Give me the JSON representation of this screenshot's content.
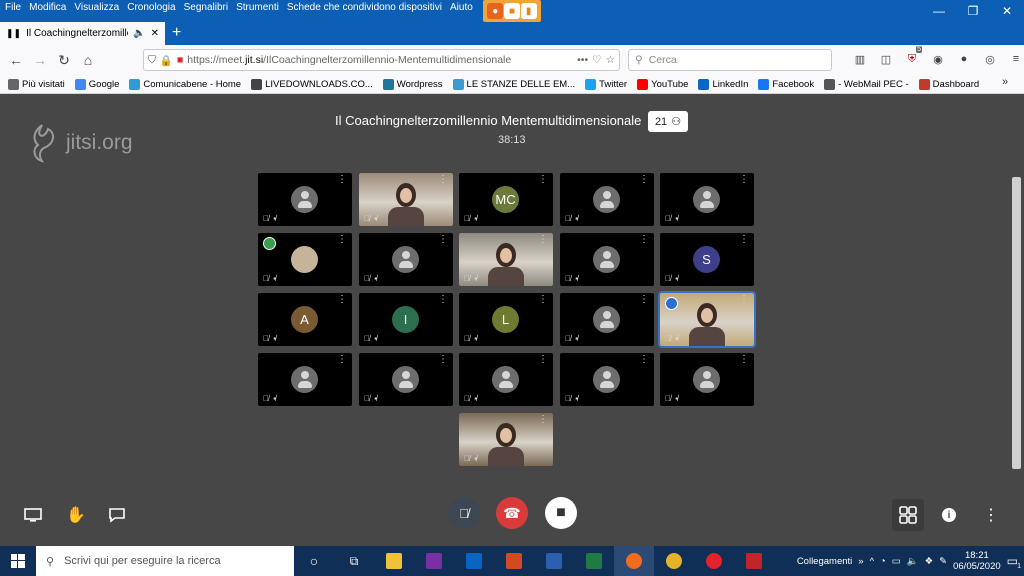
{
  "menu": [
    "File",
    "Modifica",
    "Visualizza",
    "Cronologia",
    "Segnalibri",
    "Strumenti",
    "Schede che condividono dispositivi",
    "Aiuto"
  ],
  "tab": {
    "title": "Il Coachingnelterzomillennio"
  },
  "nav": {
    "url_prefix": "https://meet.",
    "url_domain": "jit.si",
    "url_path": "/IlCoachingnelterzomillennio-Mentemultidimensionale",
    "search_placeholder": "Cerca",
    "badge": "5"
  },
  "bookmarks": [
    {
      "label": "Più visitati",
      "color": "#666"
    },
    {
      "label": "Google",
      "color": "#4285f4"
    },
    {
      "label": "Comunicabene - Home",
      "color": "#2d9cdb"
    },
    {
      "label": "LIVEDOWNLOADS.CO...",
      "color": "#444"
    },
    {
      "label": "Wordpress",
      "color": "#21759b"
    },
    {
      "label": "LE STANZE DELLE EM...",
      "color": "#3d9ad1"
    },
    {
      "label": "Twitter",
      "color": "#1da1f2"
    },
    {
      "label": "YouTube",
      "color": "#ff0000"
    },
    {
      "label": "LinkedIn",
      "color": "#0a66c2"
    },
    {
      "label": "Facebook",
      "color": "#1877f2"
    },
    {
      "label": "- WebMail PEC -",
      "color": "#555"
    },
    {
      "label": "Dashboard",
      "color": "#c0392b"
    }
  ],
  "meeting": {
    "brand": "jitsi.org",
    "title": "Il Coachingnelterzomillennio Mentemultidimensionale",
    "participants": "21",
    "timer": "38:13"
  },
  "tiles": [
    {
      "type": "generic"
    },
    {
      "type": "video",
      "tone": "#9c8b78"
    },
    {
      "type": "initial",
      "letter": "MC",
      "color": "#6b7a3b"
    },
    {
      "type": "generic"
    },
    {
      "type": "generic"
    },
    {
      "type": "photo",
      "tone": "#c5b39a",
      "conn": true
    },
    {
      "type": "generic"
    },
    {
      "type": "video",
      "tone": "#8e8a7f"
    },
    {
      "type": "generic"
    },
    {
      "type": "initial",
      "letter": "S",
      "color": "#3d3f8a"
    },
    {
      "type": "initial",
      "letter": "A",
      "color": "#7a5a33"
    },
    {
      "type": "initial",
      "letter": "I",
      "color": "#2c6e4f"
    },
    {
      "type": "initial",
      "letter": "L",
      "color": "#6d7a2f"
    },
    {
      "type": "generic"
    },
    {
      "type": "video",
      "tone": "#c4a978",
      "active": true
    },
    {
      "type": "generic"
    },
    {
      "type": "generic"
    },
    {
      "type": "generic"
    },
    {
      "type": "generic"
    },
    {
      "type": "generic"
    },
    {
      "type": "video",
      "tone": "#7a6a55"
    }
  ],
  "taskbar": {
    "search_placeholder": "Scrivi qui per eseguire la ricerca",
    "links": "Collegamenti",
    "time": "18:21",
    "date": "06/05/2020",
    "notif": "1",
    "apps": [
      {
        "name": "explorer",
        "color": "#f0c23a"
      },
      {
        "name": "onenote",
        "color": "#7a2fa5"
      },
      {
        "name": "outlook",
        "color": "#0a64c2"
      },
      {
        "name": "powerpoint",
        "color": "#d04a23"
      },
      {
        "name": "word",
        "color": "#2b5fb0"
      },
      {
        "name": "excel",
        "color": "#1f7a44"
      },
      {
        "name": "firefox",
        "color": "#f36b1c"
      },
      {
        "name": "chrome",
        "color": "#e6b22a"
      },
      {
        "name": "opera",
        "color": "#e3222b"
      },
      {
        "name": "maps",
        "color": "#c0252a"
      }
    ]
  }
}
